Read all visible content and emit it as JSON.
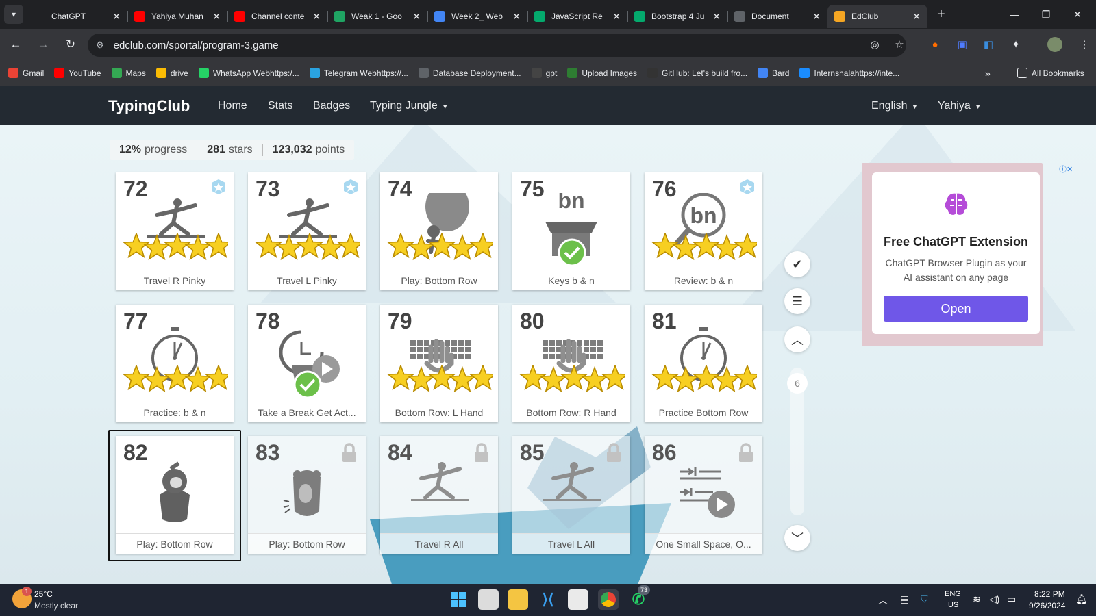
{
  "browser": {
    "tabs": [
      {
        "title": "ChatGPT",
        "icon": "chatgpt-icon",
        "color": "#202124"
      },
      {
        "title": "Yahiya Muhan",
        "icon": "youtube-icon",
        "color": "#ff0000"
      },
      {
        "title": "Channel conte",
        "icon": "youtube-icon",
        "color": "#ff0000"
      },
      {
        "title": "Weak 1 - Goo",
        "icon": "google-drive-icon",
        "color": "#1fa463"
      },
      {
        "title": "Week 2_ Web",
        "icon": "google-docs-icon",
        "color": "#4285f4"
      },
      {
        "title": "JavaScript Re",
        "icon": "w3schools-icon",
        "color": "#04aa6d"
      },
      {
        "title": "Bootstrap 4 Ju",
        "icon": "w3schools-icon",
        "color": "#04aa6d"
      },
      {
        "title": "Document",
        "icon": "globe-icon",
        "color": "#5f6368"
      },
      {
        "title": "EdClub",
        "icon": "edclub-icon",
        "color": "#f5a623"
      }
    ],
    "url": "edclub.com/sportal/program-3.game",
    "bookmarks": [
      {
        "label": "Gmail",
        "icon": "gmail-icon",
        "color": "#ea4335"
      },
      {
        "label": "YouTube",
        "icon": "youtube-icon",
        "color": "#ff0000"
      },
      {
        "label": "Maps",
        "icon": "maps-icon",
        "color": "#34a853"
      },
      {
        "label": "drive",
        "icon": "google-drive-icon",
        "color": "#fbbc04"
      },
      {
        "label": "WhatsApp Webhttps:/...",
        "icon": "whatsapp-icon",
        "color": "#25d366"
      },
      {
        "label": "Telegram Webhttps://...",
        "icon": "telegram-icon",
        "color": "#2aa3e1"
      },
      {
        "label": "Database Deployment...",
        "icon": "globe-icon",
        "color": "#5f6368"
      },
      {
        "label": "gpt",
        "icon": "chatgpt-icon",
        "color": "#444"
      },
      {
        "label": "Upload Images",
        "icon": "image-icon",
        "color": "#2e7d32"
      },
      {
        "label": "GitHub: Let's build fro...",
        "icon": "github-icon",
        "color": "#333"
      },
      {
        "label": "Bard",
        "icon": "bard-icon",
        "color": "#4285f4"
      },
      {
        "label": "Internshalahttps://inte...",
        "icon": "internshala-icon",
        "color": "#1a8cff"
      }
    ],
    "all_bookmarks": "All Bookmarks"
  },
  "site": {
    "logo": "TypingClub",
    "nav": [
      "Home",
      "Stats",
      "Badges",
      "Typing Jungle"
    ],
    "language": "English",
    "user": "Yahiya"
  },
  "stats": {
    "progress_value": "12%",
    "progress_label": "progress",
    "stars_value": "281",
    "stars_label": "stars",
    "points_value": "123,032",
    "points_label": "points"
  },
  "lessons": [
    {
      "num": "72",
      "label": "Travel R Pinky",
      "art": "yoga-icon",
      "stars": 5,
      "badge": true,
      "locked": false,
      "check": false
    },
    {
      "num": "73",
      "label": "Travel L Pinky",
      "art": "yoga-icon",
      "stars": 5,
      "badge": true,
      "locked": false,
      "check": false
    },
    {
      "num": "74",
      "label": "Play: Bottom Row",
      "art": "balloon-game-icon",
      "stars": 5,
      "badge": false,
      "locked": false,
      "check": false
    },
    {
      "num": "75",
      "label": "Keys b & n",
      "art": "new-keys-box-icon",
      "art_text": "bn",
      "stars": 0,
      "badge": false,
      "locked": false,
      "check": true
    },
    {
      "num": "76",
      "label": "Review: b & n",
      "art": "magnifier-icon",
      "art_text": "bn",
      "stars": 5,
      "badge": true,
      "locked": false,
      "check": false
    },
    {
      "num": "77",
      "label": "Practice: b & n",
      "art": "stopwatch-icon",
      "stars": 5,
      "badge": false,
      "locked": false,
      "check": false
    },
    {
      "num": "78",
      "label": "Take a Break Get Act...",
      "art": "break-video-icon",
      "stars": 0,
      "badge": false,
      "locked": false,
      "check": true
    },
    {
      "num": "79",
      "label": "Bottom Row: L Hand",
      "art": "keyboard-hand-icon",
      "stars": 5,
      "badge": false,
      "locked": false,
      "check": false
    },
    {
      "num": "80",
      "label": "Bottom Row: R Hand",
      "art": "keyboard-hand-icon",
      "stars": 5,
      "badge": false,
      "locked": false,
      "check": false
    },
    {
      "num": "81",
      "label": "Practice Bottom Row",
      "art": "stopwatch-icon",
      "stars": 5,
      "badge": false,
      "locked": false,
      "check": false
    },
    {
      "num": "82",
      "label": "Play: Bottom Row",
      "art": "creature-pot-icon",
      "stars": 0,
      "badge": false,
      "locked": false,
      "check": false
    },
    {
      "num": "83",
      "label": "Play: Bottom Row",
      "art": "bear-icon",
      "stars": 0,
      "badge": false,
      "locked": true,
      "check": false
    },
    {
      "num": "84",
      "label": "Travel R All",
      "art": "yoga-icon",
      "stars": 0,
      "badge": false,
      "locked": true,
      "check": false
    },
    {
      "num": "85",
      "label": "Travel L All",
      "art": "yoga-icon",
      "stars": 0,
      "badge": false,
      "locked": true,
      "check": false
    },
    {
      "num": "86",
      "label": "One Small Space, O...",
      "art": "spacing-video-icon",
      "stars": 0,
      "badge": false,
      "locked": true,
      "check": false
    }
  ],
  "side_controls": {
    "scroll_level": "6"
  },
  "ad": {
    "title": "Free ChatGPT Extension",
    "description": "ChatGPT Browser Plugin as your AI assistant on any page",
    "button": "Open",
    "button_color": "#6f57e8"
  },
  "taskbar": {
    "weather_temp": "25°C",
    "weather_desc": "Mostly clear",
    "weather_badge": "1",
    "whatsapp_badge": "73",
    "lang_top": "ENG",
    "lang_bottom": "US",
    "time": "8:22 PM",
    "date": "9/26/2024"
  }
}
